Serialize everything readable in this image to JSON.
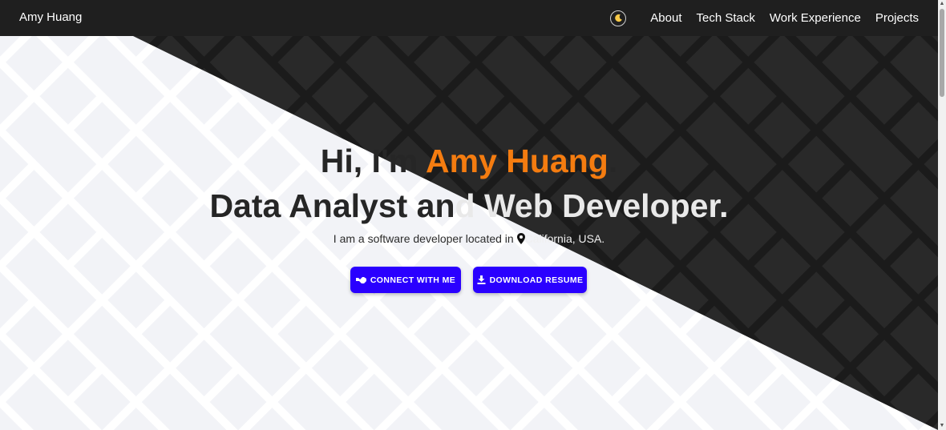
{
  "navbar": {
    "brand": "Amy Huang",
    "theme_icon": "moon-icon",
    "links": [
      "About",
      "Tech Stack",
      "Work Experience",
      "Projects"
    ]
  },
  "hero": {
    "greeting_prefix": "Hi, I'm ",
    "name": "Amy Huang",
    "greeting_suffix": ".",
    "role_left": "Data Analyst an",
    "role_right": "d Web Developer.",
    "subtitle_prefix": "I am a software developer located in ",
    "location": "California, USA.",
    "buttons": {
      "connect": "CONNECT WITH ME",
      "resume": "DOWNLOAD RESUME"
    }
  },
  "colors": {
    "accent_name": "#f47c10",
    "button_bg": "#2a00ff",
    "dark_bg": "#1b1b1b",
    "pattern_light": "#f2f3f7",
    "pattern_dark": "#292929"
  }
}
